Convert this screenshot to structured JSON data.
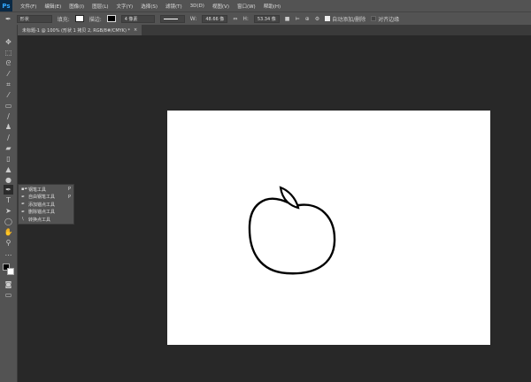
{
  "app": {
    "logo": "Ps"
  },
  "menu": [
    "文件(F)",
    "编辑(E)",
    "图像(I)",
    "图层(L)",
    "文字(Y)",
    "选择(S)",
    "滤镜(T)",
    "3D(D)",
    "视图(V)",
    "窗口(W)",
    "帮助(H)"
  ],
  "options": {
    "mode": "形状",
    "fill_label": "填充:",
    "stroke_label": "描边:",
    "stroke_width": "4 像素",
    "w_label": "W:",
    "w_value": "48.66 像",
    "h_label": "H:",
    "h_value": "53.34 像",
    "auto_add_delete": "自动添加/删除",
    "auto_add_delete_checked": true,
    "align_edges": "对齐边缘",
    "align_edges_checked": false
  },
  "tab": {
    "title": "未标题-1 @ 100% (形状 1 拷贝 2, RGB/8#/CMYK) *",
    "close": "×"
  },
  "flyout": [
    {
      "label": "钢笔工具",
      "key": "P",
      "active": true
    },
    {
      "label": "自由钢笔工具",
      "key": "P"
    },
    {
      "label": "添加锚点工具",
      "key": ""
    },
    {
      "label": "删除锚点工具",
      "key": ""
    },
    {
      "label": "转换点工具",
      "key": ""
    }
  ],
  "colors": {
    "ui": "#535353",
    "workspace": "#282828",
    "canvas": "#ffffff"
  }
}
